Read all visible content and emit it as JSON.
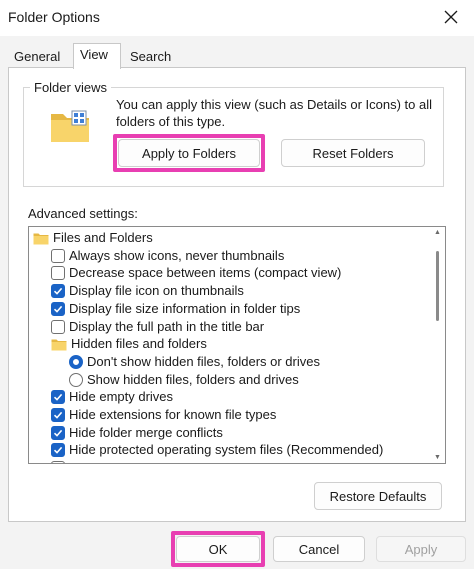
{
  "window": {
    "title": "Folder Options"
  },
  "tabs": [
    {
      "label": "General",
      "active": false
    },
    {
      "label": "View",
      "active": true
    },
    {
      "label": "Search",
      "active": false
    }
  ],
  "folder_views": {
    "legend": "Folder views",
    "description": "You can apply this view (such as Details or Icons) to all folders of this type.",
    "apply_label": "Apply to Folders",
    "reset_label": "Reset Folders"
  },
  "advanced": {
    "label": "Advanced settings:",
    "items": [
      {
        "type": "folder",
        "label": "Files and Folders",
        "indent": 0
      },
      {
        "type": "checkbox",
        "label": "Always show icons, never thumbnails",
        "checked": false,
        "indent": 1
      },
      {
        "type": "checkbox",
        "label": "Decrease space between items (compact view)",
        "checked": false,
        "indent": 1
      },
      {
        "type": "checkbox",
        "label": "Display file icon on thumbnails",
        "checked": true,
        "indent": 1
      },
      {
        "type": "checkbox",
        "label": "Display file size information in folder tips",
        "checked": true,
        "indent": 1
      },
      {
        "type": "checkbox",
        "label": "Display the full path in the title bar",
        "checked": false,
        "indent": 1
      },
      {
        "type": "folder",
        "label": "Hidden files and folders",
        "indent": 1
      },
      {
        "type": "radio",
        "label": "Don't show hidden files, folders or drives",
        "checked": true,
        "indent": 2
      },
      {
        "type": "radio",
        "label": "Show hidden files, folders and drives",
        "checked": false,
        "indent": 2
      },
      {
        "type": "checkbox",
        "label": "Hide empty drives",
        "checked": true,
        "indent": 1
      },
      {
        "type": "checkbox",
        "label": "Hide extensions for known file types",
        "checked": true,
        "indent": 1
      },
      {
        "type": "checkbox",
        "label": "Hide folder merge conflicts",
        "checked": true,
        "indent": 1
      },
      {
        "type": "checkbox",
        "label": "Hide protected operating system files (Recommended)",
        "checked": true,
        "indent": 1
      },
      {
        "type": "checkbox",
        "label": "",
        "checked": false,
        "indent": 1
      }
    ],
    "restore_label": "Restore Defaults"
  },
  "footer": {
    "ok_label": "OK",
    "cancel_label": "Cancel",
    "apply_label": "Apply"
  },
  "colors": {
    "accent": "#1a63c6",
    "highlight": "#e83fb2"
  },
  "icons": [
    "close-icon",
    "folder-icon",
    "checkmark-icon"
  ]
}
